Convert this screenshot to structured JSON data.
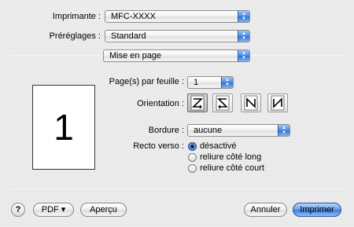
{
  "printer": {
    "label": "Imprimante :",
    "value": "MFC-XXXX"
  },
  "presets": {
    "label": "Préréglages :",
    "value": "Standard"
  },
  "panel": {
    "value": "Mise en page"
  },
  "preview": {
    "page_number": "1"
  },
  "pages_per_sheet": {
    "label": "Page(s) par feuille :",
    "value": "1"
  },
  "orientation": {
    "label": "Orientation :",
    "options": [
      "Z",
      "S",
      "N-left",
      "N-right"
    ],
    "selected_index": 0
  },
  "border": {
    "label": "Bordure :",
    "value": "aucune"
  },
  "duplex": {
    "label": "Recto verso :",
    "options": [
      {
        "label": "désactivé",
        "selected": true
      },
      {
        "label": "reliure côté long",
        "selected": false
      },
      {
        "label": "reliure côté court",
        "selected": false
      }
    ]
  },
  "footer": {
    "help": "?",
    "pdf": "PDF ▾",
    "preview": "Aperçu",
    "cancel": "Annuler",
    "print": "Imprimer"
  },
  "colors": {
    "accent": "#3d7fdb",
    "background": "#ececec"
  }
}
